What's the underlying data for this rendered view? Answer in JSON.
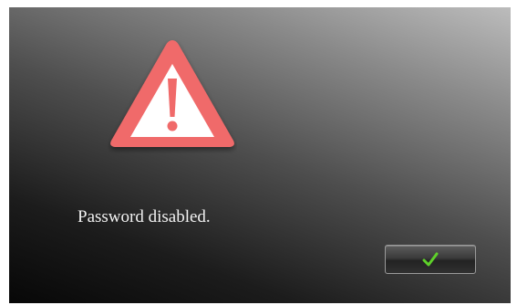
{
  "dialog": {
    "icon": "warning-triangle-icon",
    "message": "Password disabled.",
    "confirm_icon": "checkmark-icon"
  },
  "colors": {
    "warning_red": "#f06a6a",
    "warning_fill": "#ffffff",
    "check_green": "#5ed12a",
    "message_text": "#f2f2f2"
  }
}
